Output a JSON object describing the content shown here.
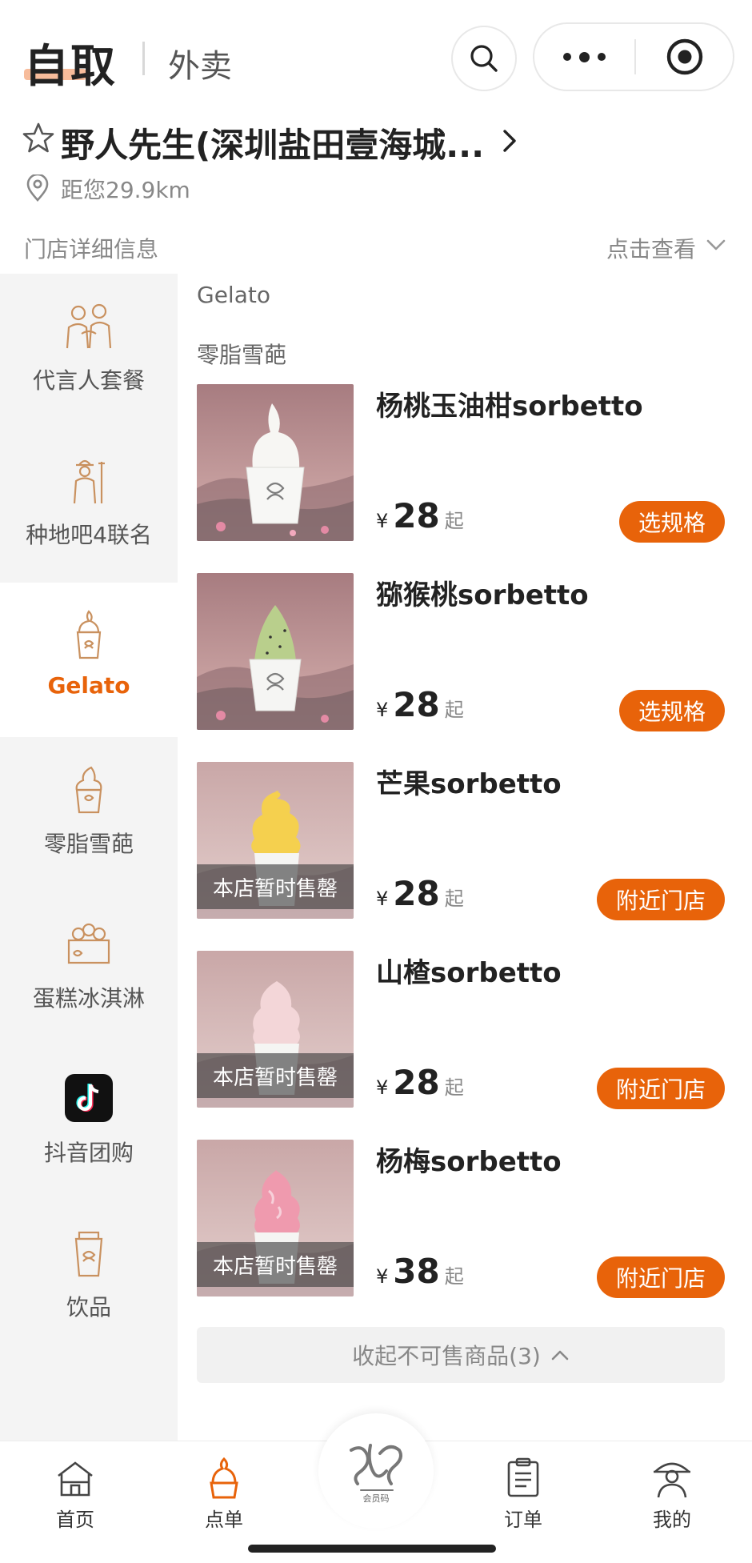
{
  "header": {
    "mode_pickup": "自取",
    "mode_delivery": "外卖",
    "icons": {
      "search": "search-icon",
      "more": "more-dots-icon",
      "close": "target-close-icon"
    }
  },
  "store": {
    "name": "野人先生(深圳盐田壹海城...",
    "distance": "距您29.9km",
    "detail_label": "门店详细信息",
    "detail_link": "点击查看"
  },
  "sidebar": {
    "items": [
      {
        "label": "代言人套餐",
        "icon": "spokesperson-icon"
      },
      {
        "label": "种地吧4联名",
        "icon": "farmer-icon"
      },
      {
        "label": "Gelato",
        "icon": "gelato-cup-icon",
        "active": true
      },
      {
        "label": "零脂雪葩",
        "icon": "sorbet-cup-icon"
      },
      {
        "label": "蛋糕冰淇淋",
        "icon": "cake-icon"
      },
      {
        "label": "抖音团购",
        "icon": "douyin-icon"
      },
      {
        "label": "饮品",
        "icon": "drink-cup-icon"
      }
    ]
  },
  "menu": {
    "section_gelato": "Gelato",
    "section_sorbet": "零脂雪葩",
    "currency": "¥",
    "price_suffix": "起",
    "sold_out_text": "本店暂时售罄",
    "products": [
      {
        "name": "杨桃玉油柑sorbetto",
        "price": "28",
        "button": "选规格",
        "sold_out": false,
        "flavor_color": "#f7f6f3"
      },
      {
        "name": "猕猴桃sorbetto",
        "price": "28",
        "button": "选规格",
        "sold_out": false,
        "flavor_color": "#b9cf8c"
      },
      {
        "name": "芒果sorbetto",
        "price": "28",
        "button": "附近门店",
        "sold_out": true,
        "flavor_color": "#f5d04e"
      },
      {
        "name": "山楂sorbetto",
        "price": "28",
        "button": "附近门店",
        "sold_out": true,
        "flavor_color": "#f3d6d8"
      },
      {
        "name": "杨梅sorbetto",
        "price": "38",
        "button": "附近门店",
        "sold_out": true,
        "flavor_color": "#ef9aae"
      }
    ],
    "collapse_label": "收起不可售商品(3)"
  },
  "tabbar": {
    "items": [
      {
        "label": "首页",
        "icon": "home-icon"
      },
      {
        "label": "点单",
        "icon": "order-gelato-icon",
        "active": true
      },
      {
        "label": "会员码",
        "icon": "member-code-logo"
      },
      {
        "label": "订单",
        "icon": "order-list-icon"
      },
      {
        "label": "我的",
        "icon": "profile-icon"
      }
    ]
  },
  "colors": {
    "accent": "#e8630a",
    "sidebar_bg": "#f4f4f4"
  }
}
